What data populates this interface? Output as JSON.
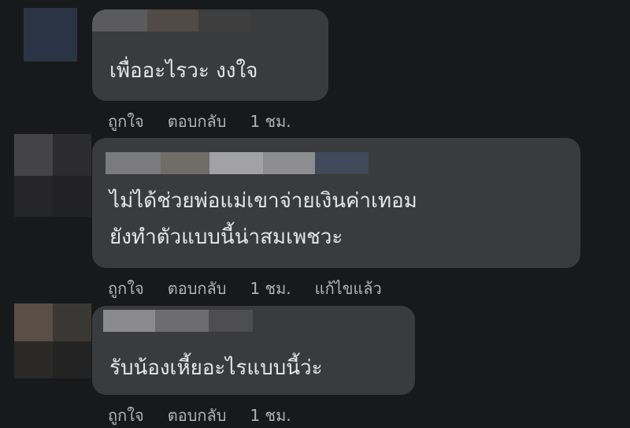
{
  "comments": [
    {
      "text_lines": [
        "เพื่ออะไรวะ งงใจ"
      ],
      "actions": {
        "like": "ถูกใจ",
        "reply": "ตอบกลับ",
        "time": "1 ชม.",
        "edited": ""
      }
    },
    {
      "text_lines": [
        "ไม่ได้ช่วยพ่อแม่เขาจ่ายเงินค่าเทอม",
        "ยังทำตัวแบบนี้น่าสมเพชวะ"
      ],
      "actions": {
        "like": "ถูกใจ",
        "reply": "ตอบกลับ",
        "time": "1 ชม.",
        "edited": "แก้ไขแล้ว"
      }
    },
    {
      "text_lines": [
        "รับน้องเหี้ยอะไรแบบนี้ว่ะ"
      ],
      "actions": {
        "like": "ถูกใจ",
        "reply": "ตอบกลับ",
        "time": "1 ชม.",
        "edited": ""
      }
    }
  ],
  "colors": {
    "background": "#18191a",
    "bubble": "#3a3b3c",
    "text": "#e4e6eb",
    "secondary_text": "#b0b3b8"
  }
}
